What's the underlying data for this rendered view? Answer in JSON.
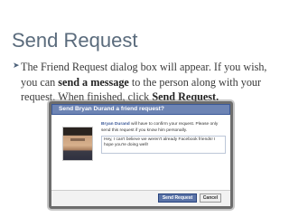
{
  "slide": {
    "title": "Send Request",
    "bullet_part1": "The Friend Request dialog box will appear. If you wish, you can ",
    "bullet_bold1": "send a message",
    "bullet_part2": " to the person along with your request. When finished, click ",
    "bullet_bold2": "Send Request."
  },
  "dialog": {
    "title": "Send Bryan Durand a friend request?",
    "confirm_name": "Bryan Durand",
    "confirm_rest": " will have to confirm your request. Please only send this request if you know him personally.",
    "message": "Hey, I can't believe we weren't already Facebook friends! I hope you're doing well!",
    "send_label": "Send Request",
    "cancel_label": "Cancel"
  },
  "colors": {
    "title": "#5a6b7c",
    "facebook_blue": "#3b5998",
    "header": "#6d84b4"
  }
}
